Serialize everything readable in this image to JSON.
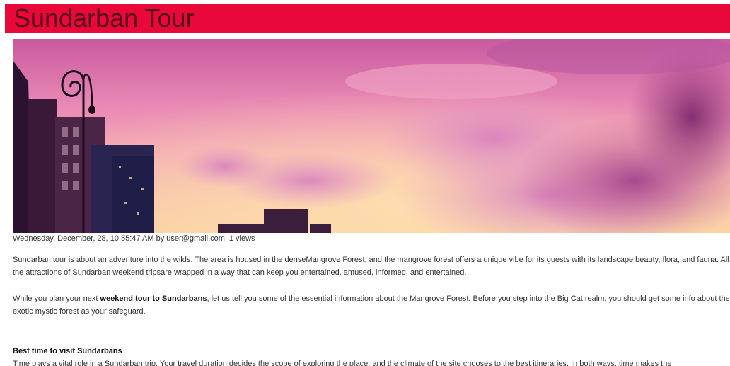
{
  "header": {
    "title": "Sundarban Tour",
    "background_color": "#e8083a",
    "text_color": "#5a0719"
  },
  "hero_image": {
    "description_icon": "sunset-sky-image"
  },
  "post_meta": {
    "text": "Wednesday, December, 28, 10:55:47 AM by user@gmail.com| 1 views"
  },
  "article": {
    "paragraph1": "Sundarban tour is about an adventure into the wilds. The area is housed in the denseMangrove Forest, and the mangrove forest offers a unique vibe for its guests with its landscape beauty, flora, and fauna. All the attractions of Sundarban weekend tripsare wrapped in a way that can keep you entertained, amused, informed, and entertained.",
    "paragraph2_before": "While you plan your next ",
    "paragraph2_link": "weekend tour to Sundarbans",
    "paragraph2_after": ", let us tell you some of the essential information about the Mangrove Forest. Before you step into the Big Cat realm, you should get some info about the exotic mystic forest as your safeguard.",
    "section_heading": "Best time to visit Sundarbans",
    "paragraph3": "Time plays a vital role in a Sundarban trip. Your travel duration decides the scope of exploring the place, and the climate of the site chooses to the best itineraries. In both ways, time makes the"
  }
}
